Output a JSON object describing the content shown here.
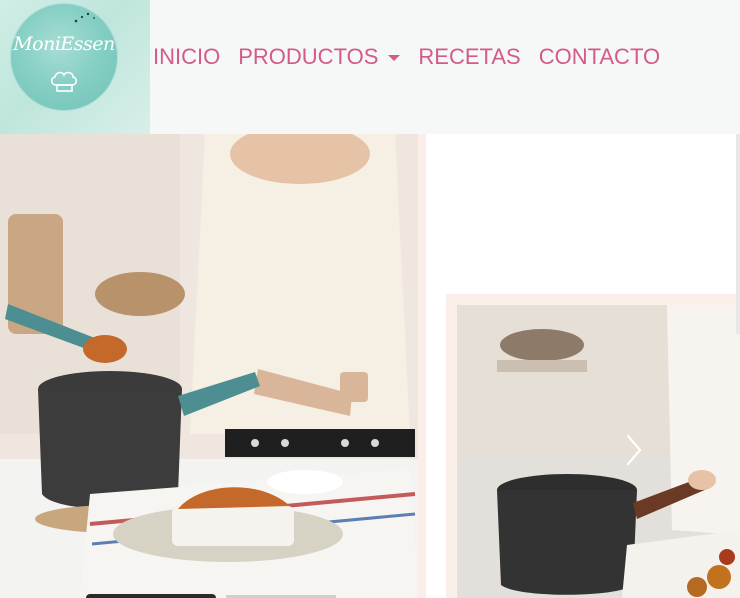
{
  "brand": {
    "logo_text": "MoniEssen"
  },
  "nav": {
    "items": [
      {
        "label": "INICIO"
      },
      {
        "label": "PRODUCTOS"
      },
      {
        "label": "RECETAS"
      },
      {
        "label": "CONTACTO"
      }
    ]
  },
  "colors": {
    "nav_link": "#d45a8c",
    "logo_teal": "#86cfc4",
    "navbar_bg": "#f5f8f7"
  },
  "carousel": {
    "slides_visible": 2,
    "next_icon": "chevron-right-icon"
  }
}
